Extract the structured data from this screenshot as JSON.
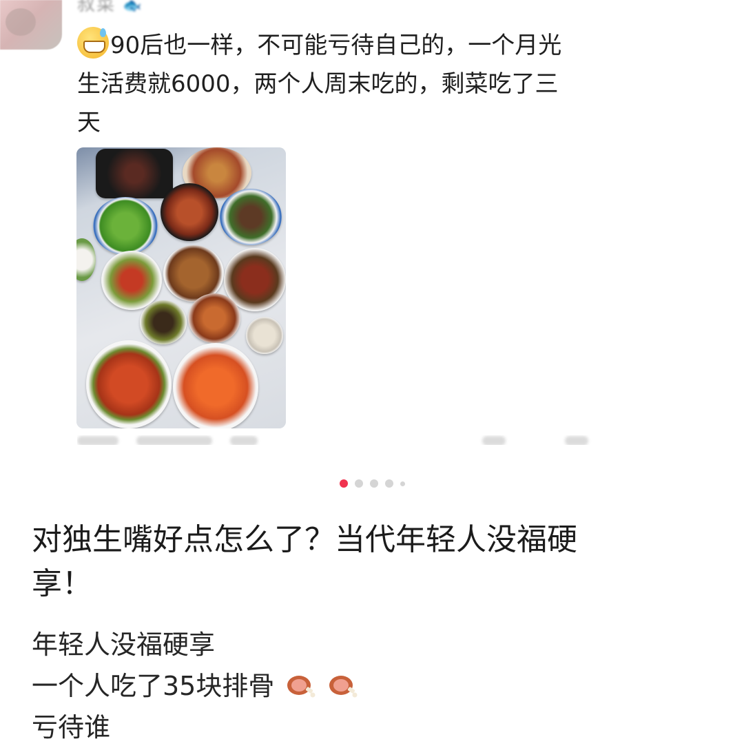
{
  "comment": {
    "username": "叔菜",
    "username_icon": "fish-icon",
    "emoji": "sweat-smile-emoji",
    "line1": "90后也一样，不可能亏待自己的，一个月光",
    "line2": "生活费就6000，两个人周末吃的，剩菜吃了三",
    "line3": "天",
    "photo_icon": "food-table-photo"
  },
  "carousel": {
    "total": 5,
    "active": 1
  },
  "post": {
    "title_line1": "对独生嘴好点怎么了？当代年轻人没福硬",
    "title_line2": "享！",
    "body_line1": "年轻人没福硬享",
    "body_line2": "一个人吃了35块排骨",
    "body_line3": "亏待谁",
    "meat_icons": [
      "meat-on-bone-icon",
      "meat-on-bone-icon"
    ]
  },
  "colors": {
    "accent": "#f0334f",
    "text": "#1b1b1b",
    "dot_inactive": "#d5d5d5"
  }
}
